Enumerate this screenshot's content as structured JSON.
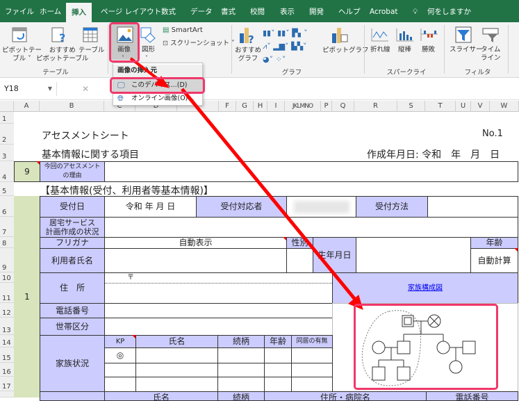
{
  "tabs": [
    "ファイル",
    "ホーム",
    "挿入",
    "ページ レイアウト",
    "数式",
    "データ",
    "書式",
    "校閲",
    "表示",
    "開発",
    "ヘルプ",
    "Acrobat",
    "何をしますか"
  ],
  "ribbon": {
    "pivot_table": "ピボットテー\nブル ˅",
    "recommended_pivot": "おすすめ\nピボットテーブル",
    "table": "テーブル",
    "group_table": "テーブル",
    "picture": "画像",
    "shapes": "図形",
    "smartart": "SmartArt",
    "screenshot": "スクリーンショット ˅",
    "recommended_chart": "おすすめ\nグラフ",
    "pivot_chart": "ピボットグラフ",
    "group_chart": "グラフ",
    "line": "折れ線",
    "column": "縦棒",
    "winloss": "勝敗",
    "group_sparkline": "スパークライン",
    "slicer": "スライサー",
    "timeline": "タイム\nライン",
    "group_filter": "フィルター"
  },
  "menu": {
    "header": "画像の挿入元",
    "this_device": "このデバイス...(D)",
    "online": "オンライン画像(O)..."
  },
  "formula_bar": {
    "name_box": "Y18",
    "cancel": "✕"
  },
  "columns": [
    "A",
    "B",
    "C",
    "D",
    "E",
    "F",
    "G",
    "H",
    "I",
    "JKLMNO",
    "P",
    "Q",
    "R",
    "S",
    "T",
    "U",
    "V",
    "W"
  ],
  "rows": [
    "1",
    "2",
    "3",
    "4",
    "5",
    "6",
    "7",
    "8",
    "9",
    "10",
    "11",
    "12",
    "13",
    "14",
    "15",
    "16",
    "17"
  ],
  "sheet": {
    "title": "アセスメントシート",
    "no": "No.1",
    "subtitle": "基本情報に関する項目",
    "created": "作成年月日: 令和　年　月　日",
    "a4": "9",
    "reason": "今回のアセスメント\nの理由",
    "section": "【基本情報(受付、利用者等基本情報)】",
    "a_block": "1",
    "reception_date": "受付日",
    "reception_date_val": "令和 年 月 日",
    "reception_person": "受付対応者",
    "reception_method": "受付方法",
    "care_plan": "居宅サービス\n計画作成の状況",
    "furigana": "フリガナ",
    "auto_display": "自動表示",
    "gender": "性別",
    "birthdate": "生年月日",
    "age": "年齢",
    "auto_calc": "自動計算",
    "user_name": "利用者氏名",
    "address": "住　所",
    "postal": "〒",
    "family_diagram_link": "家族構成図",
    "phone": "電話番号",
    "household": "世帯区分",
    "family": "家族状況",
    "family_headers": [
      "KP",
      "氏名",
      "続柄",
      "年齢",
      "同居の有無"
    ],
    "kp_mark": "◎",
    "row18_headers": [
      "氏名",
      "続柄",
      "住所・病院名",
      "電話番号"
    ]
  },
  "colors": {
    "excel_green": "#217346",
    "header_purple": "#ccccff",
    "side_green": "#d8e4bc",
    "highlight": "#f0386b",
    "arrow": "#ff0000"
  }
}
